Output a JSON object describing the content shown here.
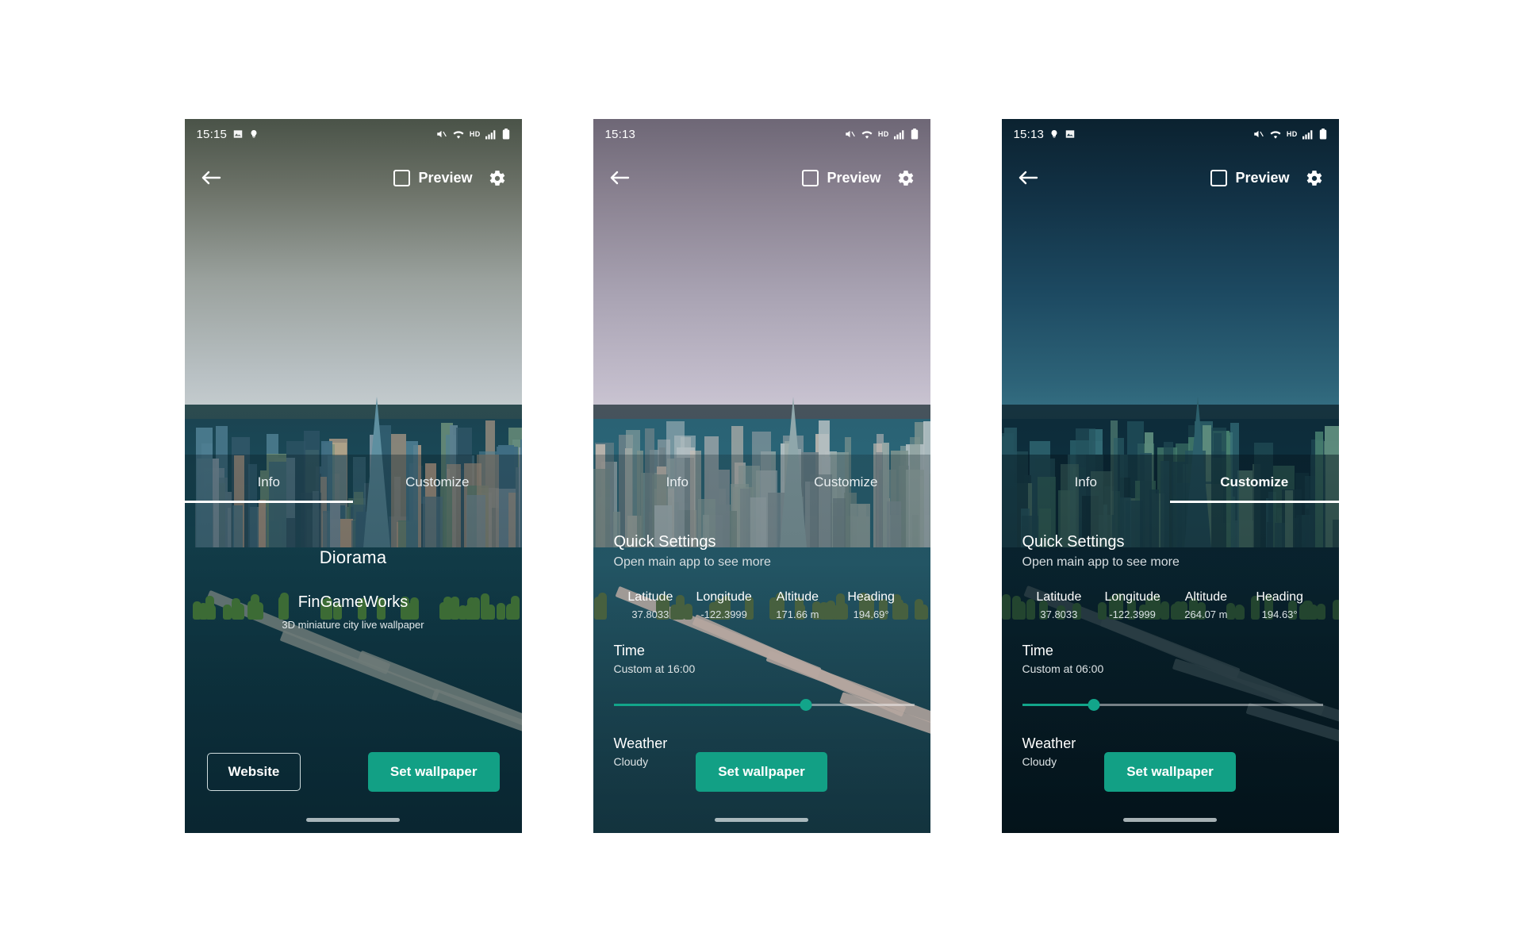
{
  "phones": [
    {
      "id": "phone-info",
      "status": {
        "time": "15:15",
        "icons": [
          "image-icon",
          "lightbulb-icon"
        ],
        "right_icons": [
          "mute-icon",
          "wifi-icon",
          "hd-icon",
          "signal-icon",
          "battery-icon"
        ],
        "hd_label": "HD"
      },
      "appbar": {
        "back": "back-arrow-icon",
        "preview_label": "Preview",
        "settings": "gear-icon",
        "preview_checked": false
      },
      "tabs": [
        {
          "label": "Info",
          "active": true
        },
        {
          "label": "Customize",
          "active": false
        }
      ],
      "mode": "info",
      "info": {
        "title": "Diorama",
        "author": "FinGameWorks",
        "description": "3D miniature city live wallpaper"
      },
      "buttons": {
        "secondary": "Website",
        "primary": "Set wallpaper"
      }
    },
    {
      "id": "phone-customize-16",
      "status": {
        "time": "15:13",
        "icons": [],
        "right_icons": [
          "mute-icon",
          "wifi-icon",
          "hd-icon",
          "signal-icon",
          "battery-icon"
        ],
        "hd_label": "HD"
      },
      "appbar": {
        "back": "back-arrow-icon",
        "preview_label": "Preview",
        "settings": "gear-icon",
        "preview_checked": false
      },
      "tabs": [
        {
          "label": "Info",
          "active": false
        },
        {
          "label": "Customize",
          "active": false
        }
      ],
      "mode": "customize",
      "customize": {
        "title": "Quick Settings",
        "subtitle": "Open main app to see more",
        "metrics": [
          {
            "label": "Latitude",
            "value": "37.8033"
          },
          {
            "label": "Longitude",
            "value": "-122.3999"
          },
          {
            "label": "Altitude",
            "value": "171.66 m"
          },
          {
            "label": "Heading",
            "value": "194.69°"
          }
        ],
        "time": {
          "label": "Time",
          "value": "Custom at 16:00",
          "slider_percent": 64
        },
        "weather": {
          "label": "Weather",
          "value": "Cloudy"
        }
      },
      "buttons": {
        "primary": "Set wallpaper"
      }
    },
    {
      "id": "phone-customize-06",
      "status": {
        "time": "15:13",
        "icons": [
          "lightbulb-icon",
          "image-icon"
        ],
        "right_icons": [
          "mute-icon",
          "wifi-icon",
          "hd-icon",
          "signal-icon",
          "battery-icon"
        ],
        "hd_label": "HD"
      },
      "appbar": {
        "back": "back-arrow-icon",
        "preview_label": "Preview",
        "settings": "gear-icon",
        "preview_checked": false
      },
      "tabs": [
        {
          "label": "Info",
          "active": false
        },
        {
          "label": "Customize",
          "active": true
        }
      ],
      "mode": "customize",
      "customize": {
        "title": "Quick Settings",
        "subtitle": "Open main app to see more",
        "metrics": [
          {
            "label": "Latitude",
            "value": "37.8033"
          },
          {
            "label": "Longitude",
            "value": "-122.3999"
          },
          {
            "label": "Altitude",
            "value": "264.07 m"
          },
          {
            "label": "Heading",
            "value": "194.63°"
          }
        ],
        "time": {
          "label": "Time",
          "value": "Custom at 06:00",
          "slider_percent": 24
        },
        "weather": {
          "label": "Weather",
          "value": "Cloudy"
        }
      },
      "buttons": {
        "primary": "Set wallpaper"
      }
    }
  ],
  "theme": {
    "accent": "#12a085",
    "slider_accent": "#12a58a",
    "text_primary": "#ffffff",
    "text_secondary": "#d9e1e4",
    "page_background": "#ffffff"
  }
}
